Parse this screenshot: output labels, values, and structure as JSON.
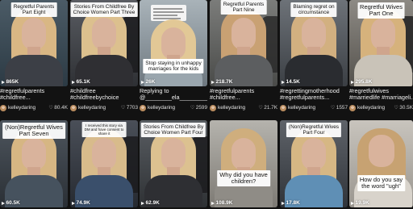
{
  "videos": [
    {
      "caption": [
        "Regretful Parents",
        "Part Eight"
      ],
      "views": "865K",
      "desc": [
        "#regretfulparents",
        "#childfree..."
      ],
      "author": "kelleydaring",
      "likes": "80.4K"
    },
    {
      "caption": [
        "Stories From Childfree By",
        "Choice Women Part Three"
      ],
      "views": "65.1K",
      "desc": [
        "#childfree",
        "#childfreebychoice"
      ],
      "author": "kelleydaring",
      "likes": "7703"
    },
    {
      "caption": [
        "Stop staying in unhappy",
        "marriages for the kids"
      ],
      "views": "26K",
      "desc": [
        "Replying to",
        "@________ela__________..."
      ],
      "author": "kelleydaring",
      "likes": "2599"
    },
    {
      "caption": [
        "Regretful Parents",
        "Part Nine"
      ],
      "views": "218.7K",
      "desc": [
        "#regretfulparents",
        "#childfree..."
      ],
      "author": "kelleydaring",
      "likes": "21.7K"
    },
    {
      "caption": [
        "Blaming regret on",
        "circumstance"
      ],
      "views": "14.5K",
      "desc": [
        "#regrettingmotherhood",
        "#regretfulparents..."
      ],
      "author": "kelleydaring",
      "likes": "1557"
    },
    {
      "caption": [
        "Regretful Wives",
        "Part One"
      ],
      "views": "295.8K",
      "desc": [
        "#regretfulwives",
        "#marriedlife #marriageli..."
      ],
      "author": "kelleydaring",
      "likes": "30.5K"
    },
    {
      "caption": [
        "(Non)Regretful Wives",
        "Part Seven"
      ],
      "views": "60.5K",
      "desc": [],
      "author": "",
      "likes": ""
    },
    {
      "caption": [
        "Stories From Childfree By",
        "Choice Women Part Four"
      ],
      "views": "62.9K",
      "desc": [],
      "author": "",
      "likes": ""
    },
    {
      "caption": [
        "Why did you have",
        "children?"
      ],
      "views": "108.9K",
      "desc": [],
      "author": "",
      "likes": ""
    },
    {
      "caption": [
        "(Non)Regretful Wives",
        "Part Four"
      ],
      "views": "17.8K",
      "desc": [],
      "author": "",
      "likes": ""
    },
    {
      "caption": [
        "How do you say",
        "the word \"ugh\""
      ],
      "views": "19.9K",
      "desc": [],
      "author": "",
      "likes": ""
    },
    {
      "caption": [],
      "views": "74.9K",
      "desc": [],
      "author": "",
      "likes": "",
      "overlay": [
        "I received this story via",
        "DM and have consent to",
        "share it"
      ]
    }
  ],
  "colors": {
    "background": "#121212",
    "text": "#ffffff",
    "caption_bg": "#ffffff"
  }
}
